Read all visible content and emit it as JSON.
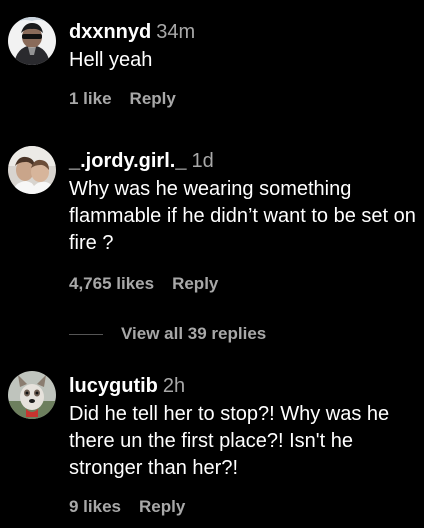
{
  "colors": {
    "background": "#000000",
    "primary_text": "#ffffff",
    "secondary_text": "#a8a8a8",
    "divider": "#555555"
  },
  "comments": [
    {
      "username": "dxxnnyd",
      "time": "34m",
      "text": "Hell yeah",
      "likes": "1 like",
      "reply_label": "Reply",
      "avatar_icon": "profile-photo"
    },
    {
      "username": "_.jordy.girl._",
      "time": "1d",
      "text": "Why was he wearing something flammable if he didn’t want to be set on fire ?",
      "likes": "4,765 likes",
      "reply_label": "Reply",
      "avatar_icon": "profile-photo"
    },
    {
      "username": "lucygutib",
      "time": "2h",
      "text": "Did he tell her to stop?! Why was he there un the first place?! Isn't he stronger than her?!",
      "likes": "9 likes",
      "reply_label": "Reply",
      "avatar_icon": "profile-photo-dog"
    }
  ],
  "view_replies": {
    "label": "View all 39 replies"
  }
}
